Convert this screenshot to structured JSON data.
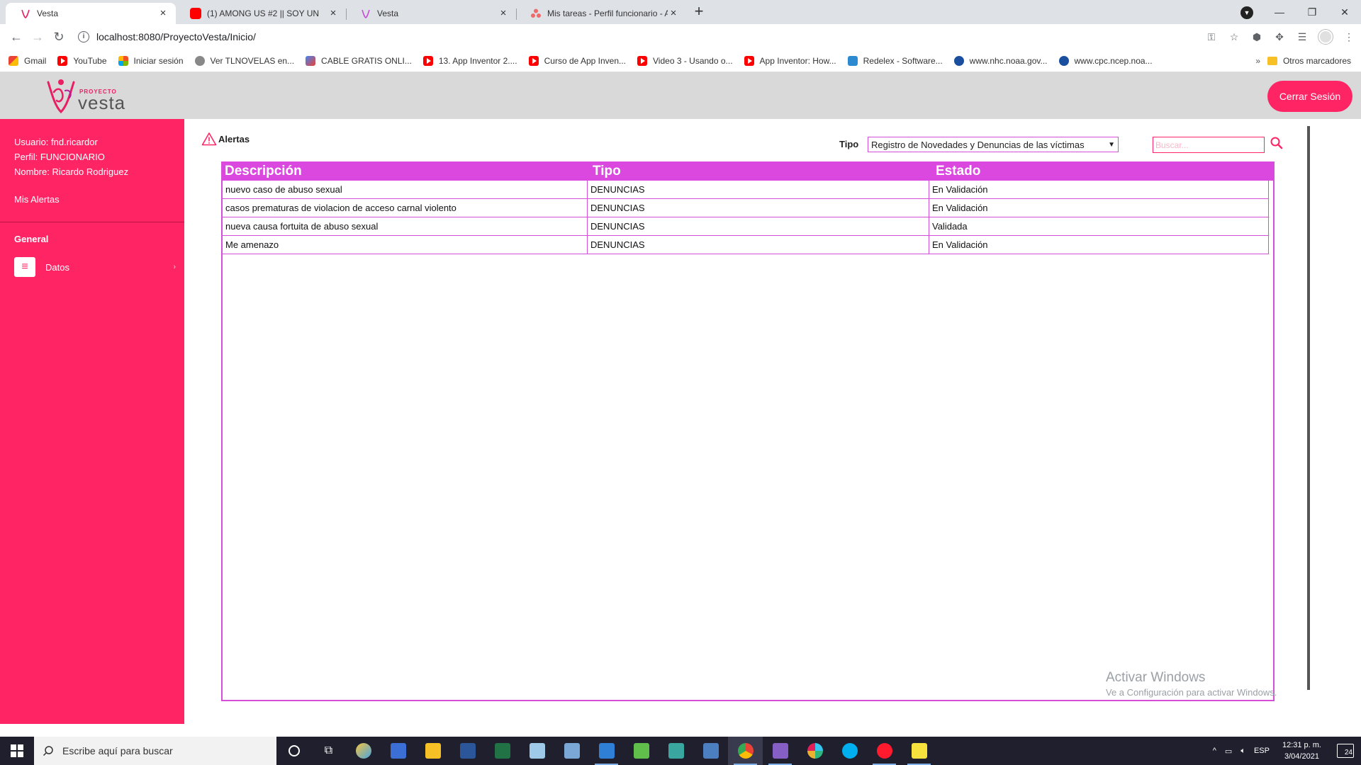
{
  "browser": {
    "tabs": [
      {
        "title": "Vesta",
        "icon": "vesta-icon",
        "active": true
      },
      {
        "title": "(1) AMONG US #2 || SOY UN",
        "icon": "youtube-icon",
        "active": false
      },
      {
        "title": "Vesta",
        "icon": "vesta-icon",
        "active": false
      },
      {
        "title": "Mis tareas - Perfil funcionario - A",
        "icon": "asana-icon",
        "active": false
      }
    ],
    "url": "localhost:8080/ProyectoVesta/Inicio/",
    "bookmarks": [
      {
        "label": "Gmail",
        "icon": "gmail-icon"
      },
      {
        "label": "YouTube",
        "icon": "youtube-icon"
      },
      {
        "label": "Iniciar sesión",
        "icon": "microsoft-icon"
      },
      {
        "label": "Ver TLNOVELAS en...",
        "icon": "globe-icon"
      },
      {
        "label": "CABLE GRATIS ONLI...",
        "icon": "doc-icon"
      },
      {
        "label": "13. App Inventor 2....",
        "icon": "youtube-icon"
      },
      {
        "label": "Curso de App Inven...",
        "icon": "youtube-icon"
      },
      {
        "label": "Video 3 - Usando o...",
        "icon": "youtube-icon"
      },
      {
        "label": "App Inventor: How...",
        "icon": "youtube-icon"
      },
      {
        "label": "Redelex - Software...",
        "icon": "redelex-icon"
      },
      {
        "label": "www.nhc.noaa.gov...",
        "icon": "noaa-icon"
      },
      {
        "label": "www.cpc.ncep.noa...",
        "icon": "noaa-icon"
      }
    ],
    "bookmarks_more": "»",
    "other_bookmarks": "Otros marcadores"
  },
  "app": {
    "logo_small": "PROYECTO",
    "logo_word": "vesta",
    "logout_label": "Cerrar Sesión",
    "brand_color": "#ff2565",
    "accent_color": "#db48e0"
  },
  "sidebar": {
    "user": "Usuario: fnd.ricardor",
    "profile": "Perfil: FUNCIONARIO",
    "name": "Nombre: Ricardo Rodriguez",
    "my_alerts": "Mis Alertas",
    "section_general": "General",
    "datos_label": "Datos"
  },
  "main": {
    "title": "Alertas",
    "type_label": "Tipo",
    "type_selected": "Registro de Novedades y Denuncias de las víctimas",
    "search_placeholder": "Buscar...",
    "table": {
      "headers": [
        "Descripción",
        "Tipo",
        "Estado"
      ],
      "rows": [
        [
          "nuevo caso de abuso sexual",
          "DENUNCIAS",
          "En Validación"
        ],
        [
          "casos prematuras de violacion de acceso carnal violento",
          "DENUNCIAS",
          "En Validación"
        ],
        [
          "nueva causa fortuita de abuso sexual",
          "DENUNCIAS",
          "Validada"
        ],
        [
          "Me amenazo",
          "DENUNCIAS",
          "En Validación"
        ]
      ]
    },
    "watermark_title": "Activar Windows",
    "watermark_sub": "Ve a Configuración para activar Windows."
  },
  "taskbar": {
    "search_placeholder": "Escribe aquí para buscar",
    "language": "ESP",
    "time": "12:31 p. m.",
    "date": "3/04/2021",
    "notifications": "24"
  }
}
